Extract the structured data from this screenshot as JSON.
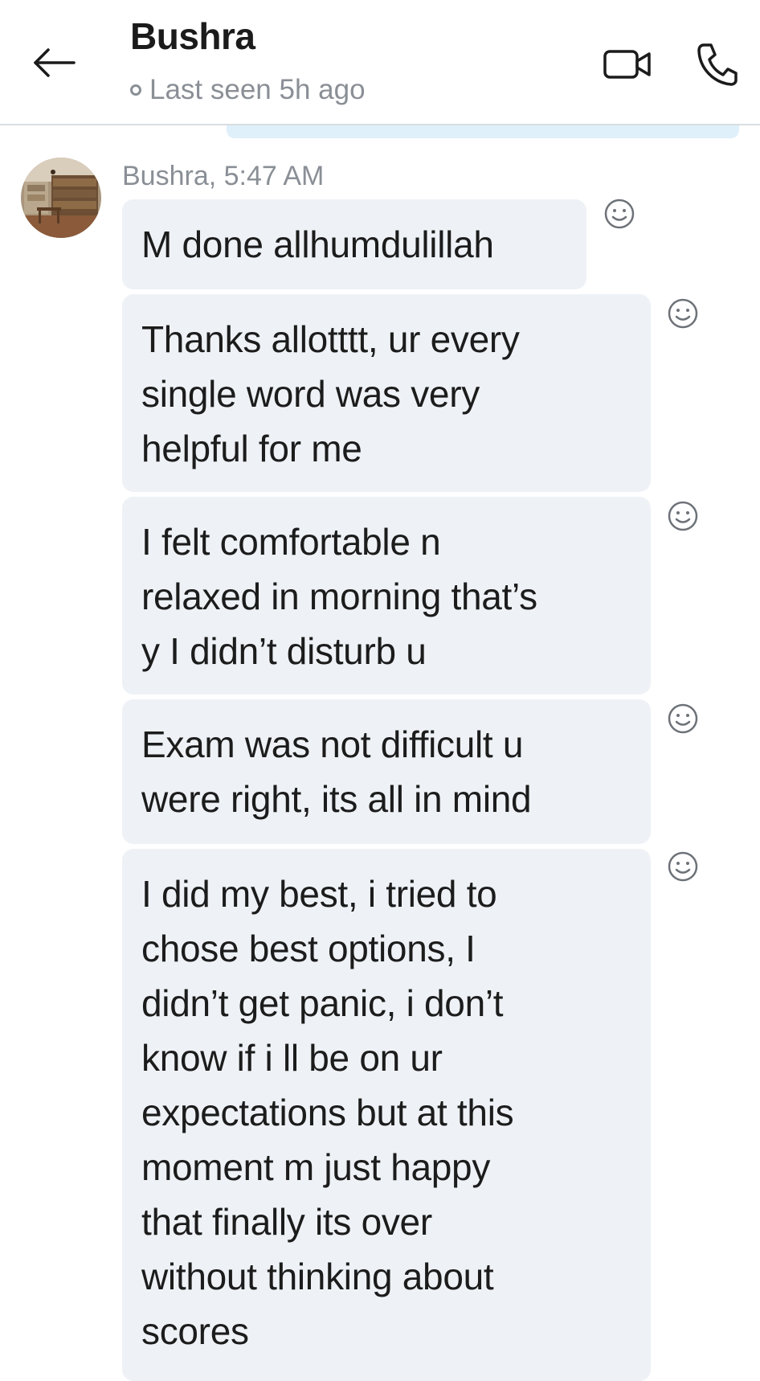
{
  "header": {
    "contact_name": "Bushra",
    "presence": "Last seen 5h ago"
  },
  "thread": {
    "sender_meta": "Bushra, 5:47 AM",
    "messages": [
      {
        "lines": [
          "M done allhumdulillah"
        ]
      },
      {
        "lines": [
          "Thanks allotttt, ur every",
          "single word was very",
          "helpful for me"
        ]
      },
      {
        "lines": [
          "I felt comfortable n",
          "relaxed in morning that’s",
          "y I didn’t disturb u"
        ]
      },
      {
        "lines": [
          "Exam was not difficult u",
          "were right, its all in mind"
        ]
      },
      {
        "lines": [
          "I did my best, i tried to",
          "chose best options, I",
          "didn’t get panic, i don’t",
          "know if i ll be on ur",
          "expectations but at this",
          "moment m just happy",
          "that finally its over",
          "without thinking about",
          "scores"
        ]
      }
    ]
  },
  "icons": {
    "back": "arrow-left-icon",
    "video": "video-camera-icon",
    "call": "phone-icon",
    "react": "smiley-face-icon"
  },
  "colors": {
    "bubble_background": "#eef2f6",
    "meta_text": "#8a8f96",
    "accent_bar": "#dff0fa"
  }
}
